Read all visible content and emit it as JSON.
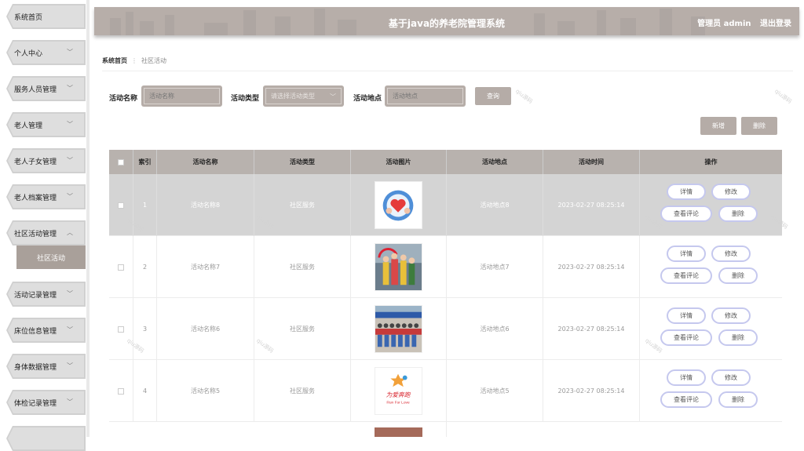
{
  "sidebar": {
    "items": [
      {
        "label": "系统首页",
        "chevron": false
      },
      {
        "label": "个人中心",
        "chevron": true
      },
      {
        "label": "服务人员管理",
        "chevron": true
      },
      {
        "label": "老人管理",
        "chevron": true
      },
      {
        "label": "老人子女管理",
        "chevron": true
      },
      {
        "label": "老人档案管理",
        "chevron": true
      },
      {
        "label": "社区活动管理",
        "chevron": true,
        "expanded": true
      },
      {
        "label": "活动记录管理",
        "chevron": true
      },
      {
        "label": "床位信息管理",
        "chevron": true
      },
      {
        "label": "身体数据管理",
        "chevron": true
      },
      {
        "label": "体检记录管理",
        "chevron": true
      }
    ],
    "sub_item": "社区活动"
  },
  "header": {
    "title": "基于java的养老院管理系统",
    "user": "管理员 admin",
    "logout": "退出登录"
  },
  "breadcrumb": {
    "home": "系统首页",
    "separator": "⋮",
    "current": "社区活动"
  },
  "search": {
    "name_label": "活动名称",
    "name_placeholder": "活动名称",
    "type_label": "活动类型",
    "type_placeholder": "请选择活动类型",
    "location_label": "活动地点",
    "location_placeholder": "活动地点",
    "query_button": "查询"
  },
  "actions": {
    "add": "新增",
    "delete": "删除"
  },
  "table": {
    "headers": [
      "索引",
      "活动名称",
      "活动类型",
      "活动图片",
      "活动地点",
      "活动时间",
      "操作"
    ],
    "rows": [
      {
        "index": "1",
        "name": "活动名称8",
        "type": "社区服务",
        "location": "活动地点8",
        "time": "2023-02-27 08:25:14",
        "image": "heart-hands-image"
      },
      {
        "index": "2",
        "name": "活动名称7",
        "type": "社区服务",
        "location": "活动地点7",
        "time": "2023-02-27 08:25:14",
        "image": "group-photo-image"
      },
      {
        "index": "3",
        "name": "活动名称6",
        "type": "社区服务",
        "location": "活动地点6",
        "time": "2023-02-27 08:25:14",
        "image": "crowd-photo-image"
      },
      {
        "index": "4",
        "name": "活动名称5",
        "type": "社区服务",
        "location": "活动地点5",
        "time": "2023-02-27 08:25:14",
        "image": "run-for-love-logo"
      }
    ],
    "op_labels": {
      "detail": "详情",
      "edit": "修改",
      "review": "查看评论",
      "delete": "删除"
    }
  },
  "logo_text": {
    "run_for_love": "Run For Love",
    "love_cn": "为爱奔跑"
  },
  "watermark": "qiu源码"
}
